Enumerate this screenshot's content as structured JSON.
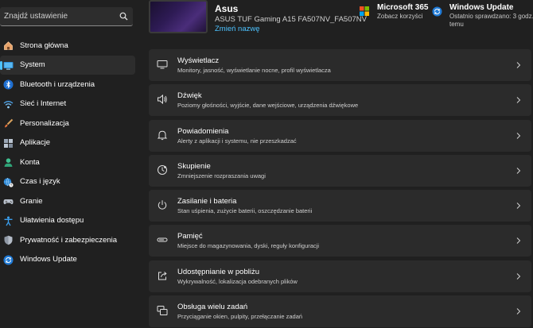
{
  "search": {
    "placeholder": "Znajdź ustawienie"
  },
  "sidebar": {
    "items": [
      {
        "label": "Strona główna",
        "icon": "home-icon"
      },
      {
        "label": "System",
        "icon": "system-display-icon",
        "active": true
      },
      {
        "label": "Bluetooth i urządzenia",
        "icon": "bluetooth-icon"
      },
      {
        "label": "Sieć i Internet",
        "icon": "wifi-icon"
      },
      {
        "label": "Personalizacja",
        "icon": "brush-icon"
      },
      {
        "label": "Aplikacje",
        "icon": "apps-icon"
      },
      {
        "label": "Konta",
        "icon": "account-icon"
      },
      {
        "label": "Czas i język",
        "icon": "globe-clock-icon"
      },
      {
        "label": "Granie",
        "icon": "gamepad-icon"
      },
      {
        "label": "Ułatwienia dostępu",
        "icon": "accessibility-icon"
      },
      {
        "label": "Prywatność i zabezpieczenia",
        "icon": "shield-icon"
      },
      {
        "label": "Windows Update",
        "icon": "windows-update-icon"
      }
    ]
  },
  "header": {
    "device_name": "Asus",
    "device_model": "ASUS TUF Gaming A15 FA507NV_FA507NV",
    "rename_label": "Zmień nazwę",
    "ms365": {
      "title": "Microsoft 365",
      "subtitle": "Zobacz korzyści"
    },
    "update": {
      "title": "Windows Update",
      "subtitle_line1": "Ostatnio sprawdzano: 3 godz.",
      "subtitle_line2": "temu"
    }
  },
  "cards": [
    {
      "title": "Wyświetlacz",
      "subtitle": "Monitory, jasność, wyświetlanie nocne, profil wyświetlacza",
      "icon": "monitor-icon"
    },
    {
      "title": "Dźwięk",
      "subtitle": "Poziomy głośności, wyjście, dane wejściowe, urządzenia dźwiękowe",
      "icon": "speaker-icon"
    },
    {
      "title": "Powiadomienia",
      "subtitle": "Alerty z aplikacji i systemu, nie przeszkadzać",
      "icon": "bell-icon"
    },
    {
      "title": "Skupienie",
      "subtitle": "Zmniejszenie rozpraszania uwagi",
      "icon": "focus-icon"
    },
    {
      "title": "Zasilanie i bateria",
      "subtitle": "Stan uśpienia, zużycie baterii, oszczędzanie baterii",
      "icon": "power-icon"
    },
    {
      "title": "Pamięć",
      "subtitle": "Miejsce do magazynowania, dyski, reguły konfiguracji",
      "icon": "storage-icon"
    },
    {
      "title": "Udostępnianie w pobliżu",
      "subtitle": "Wykrywalność, lokalizacja odebranych plików",
      "icon": "share-icon"
    },
    {
      "title": "Obsługa wielu zadań",
      "subtitle": "Przyciąganie okien, pulpity, przełączanie zadań",
      "icon": "multitask-icon"
    }
  ],
  "colors": {
    "accent": "#4cc2ff",
    "background": "#202020",
    "card": "#2b2b2b"
  }
}
